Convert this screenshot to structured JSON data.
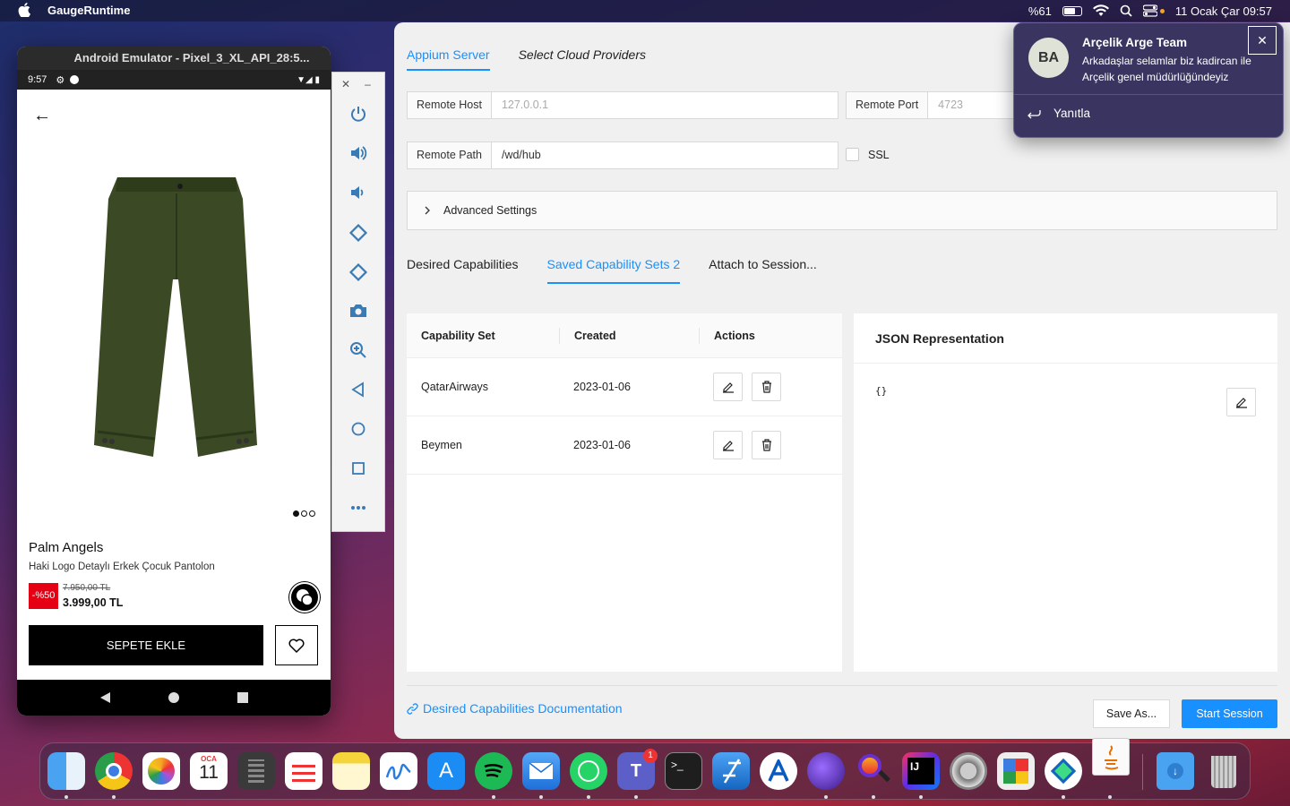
{
  "menubar": {
    "app_name": "GaugeRuntime",
    "battery": "%61",
    "datetime": "11 Ocak Çar  09:57"
  },
  "emulator": {
    "window_title": "Android Emulator - Pixel_3_XL_API_28:5...",
    "status_time": "9:57",
    "product": {
      "brand": "Palm Angels",
      "description": "Haki Logo Detaylı Erkek Çocuk Pantolon",
      "discount": "-%50",
      "old_price": "7.950,00 TL",
      "new_price": "3.999,00 TL",
      "add_to_cart": "SEPETE EKLE",
      "image_pages": 3,
      "current_page": 1
    },
    "toolbar_icons": [
      "power-icon",
      "volume-up-icon",
      "volume-down-icon",
      "rotate-left-icon",
      "rotate-right-icon",
      "camera-icon",
      "zoom-icon",
      "back-icon",
      "home-icon",
      "overview-icon",
      "more-icon"
    ]
  },
  "appium": {
    "tabs": [
      "Appium Server",
      "Select Cloud Providers"
    ],
    "remote_host_label": "Remote Host",
    "remote_host_placeholder": "127.0.0.1",
    "remote_port_label": "Remote Port",
    "remote_port_placeholder": "4723",
    "remote_path_label": "Remote Path",
    "remote_path_value": "/wd/hub",
    "ssl_label": "SSL",
    "advanced_settings": "Advanced Settings",
    "cap_tabs": [
      "Desired Capabilities",
      "Saved Capability Sets 2",
      "Attach to Session..."
    ],
    "table": {
      "headers": [
        "Capability Set",
        "Created",
        "Actions"
      ],
      "rows": [
        {
          "name": "QatarAirways",
          "created": "2023-01-06"
        },
        {
          "name": "Beymen",
          "created": "2023-01-06"
        }
      ]
    },
    "json_title": "JSON Representation",
    "json_body": "{}",
    "doc_link": "Desired Capabilities Documentation",
    "save_as": "Save As...",
    "start_session": "Start Session",
    "accent": "#1890ff"
  },
  "notification": {
    "avatar": "BA",
    "title": "Arçelik Arge Team",
    "message": "Arkadaşlar selamlar biz kadircan ile Arçelik genel müdürlüğündeyiz",
    "reply": "Yanıtla"
  },
  "dock": {
    "calendar_month": "OCA",
    "calendar_day": "11",
    "teams_badge": "1",
    "intellij_label": "IJ"
  }
}
